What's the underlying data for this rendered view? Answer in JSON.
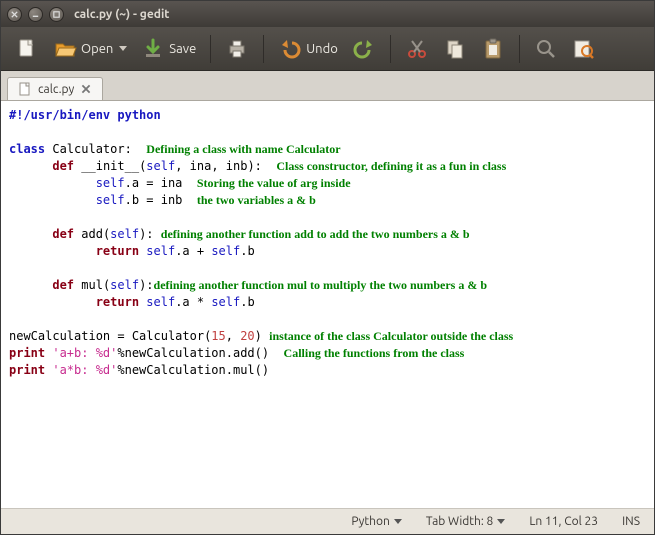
{
  "title": "calc.py (~) - gedit",
  "toolbar": {
    "open": "Open",
    "save": "Save",
    "undo": "Undo"
  },
  "tab": {
    "name": "calc.py"
  },
  "code": {
    "shebang": "#!/usr/bin/env python",
    "class_kw": "class",
    "class_name": " Calculator:",
    "def_kw": "def",
    "init_sig": " __init__(",
    "comma_ina": ", ina, inb):",
    "self": "self",
    "selfdot": "self",
    "assign_a": ".a = ina",
    "assign_b": ".b = inb",
    "add_sig": " add(",
    "close_paren": "):",
    "return_kw": "return",
    "add_expr_a": ".a + ",
    "add_expr_b": ".b",
    "mul_sig": " mul(",
    "mul_expr_a": ".a * ",
    "mul_expr_b": ".b",
    "newCalc": "newCalculation = Calculator(",
    "n15": "15",
    "n20": "20",
    "comma_sp": ", ",
    "close_paren2": ")",
    "print_kw": "print",
    "str1": " 'a+b: %d'",
    "call1": "%newCalculation.add()",
    "str2": " 'a*b: %d'",
    "call2": "%newCalculation.mul()"
  },
  "anno": {
    "class_def": "Defining a class with name Calculator",
    "ctor": "Class constructor, defining it as a fun in class",
    "store1": "Storing the value of arg inside",
    "store2": "the two variables a & b",
    "add": "defining another function add to add the two numbers a & b",
    "mul": "defining another function mul to multiply the two numbers a & b",
    "instance": "instance of the class Calculator outside the class",
    "calling": "Calling the functions from the class"
  },
  "status": {
    "lang": "Python",
    "tabwidth": "Tab Width:  8",
    "pos": "Ln 11, Col 23",
    "ins": "INS"
  }
}
